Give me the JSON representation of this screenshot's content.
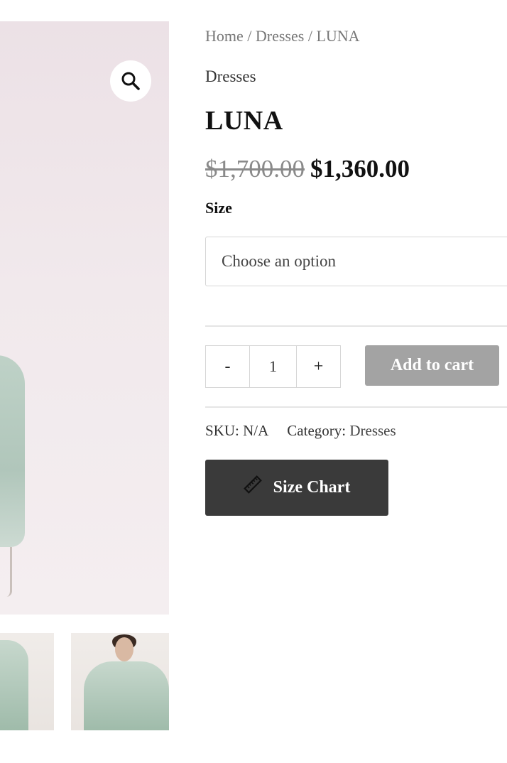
{
  "breadcrumb": {
    "home": "Home",
    "sep": " / ",
    "category": "Dresses",
    "current": "LUNA"
  },
  "product": {
    "category": "Dresses",
    "title": "LUNA",
    "price_old": "$1,700.00",
    "price_new": "$1,360.00"
  },
  "variation": {
    "label": "Size",
    "placeholder": "Choose an option"
  },
  "quantity": {
    "minus": "-",
    "value": "1",
    "plus": "+"
  },
  "cart": {
    "add_label": "Add to cart"
  },
  "meta": {
    "sku_label": "SKU:",
    "sku_value": "N/A",
    "category_label": "Category:",
    "category_value": "Dresses"
  },
  "size_chart": {
    "label": "Size Chart"
  },
  "icons": {
    "zoom": "magnifier-icon",
    "ruler": "ruler-icon"
  },
  "colors": {
    "add_to_cart_bg": "#a3a3a3",
    "size_chart_bg": "#3a3a3a"
  }
}
